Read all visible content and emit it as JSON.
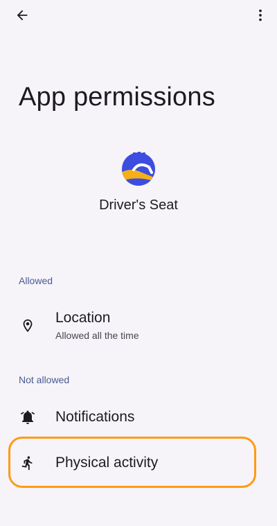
{
  "top_bar": {
    "back_icon": "arrow-back-icon",
    "more_icon": "more-vert-icon"
  },
  "page_title": "App permissions",
  "app": {
    "name": "Driver's Seat",
    "icon": "drivers-seat-logo",
    "icon_colors": {
      "blue": "#3d4de0",
      "yellow": "#f5b018",
      "white": "#ffffff"
    }
  },
  "sections": {
    "allowed": {
      "header": "Allowed",
      "items": [
        {
          "title": "Location",
          "subtitle": "Allowed all the time",
          "icon": "location-pin-icon"
        }
      ]
    },
    "not_allowed": {
      "header": "Not allowed",
      "items": [
        {
          "title": "Notifications",
          "icon": "notifications-off-icon"
        },
        {
          "title": "Physical activity",
          "icon": "directions-run-icon"
        }
      ]
    }
  },
  "colors": {
    "background": "#f6f4f9",
    "section_header": "#4a5a92",
    "highlight": "#ff9a12"
  }
}
